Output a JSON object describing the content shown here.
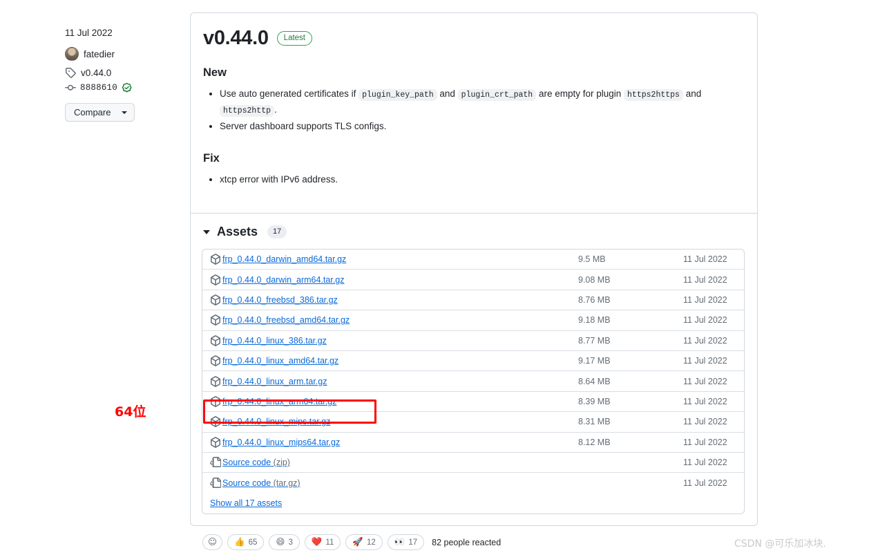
{
  "sidebar": {
    "date": "11 Jul 2022",
    "author": "fatedier",
    "tag": "v0.44.0",
    "commit": "8888610",
    "compare_label": "Compare"
  },
  "release": {
    "title": "v0.44.0",
    "badge": "Latest",
    "sections": [
      {
        "heading": "New",
        "items": [
          {
            "parts": [
              {
                "type": "text",
                "value": "Use auto generated certificates if "
              },
              {
                "type": "code",
                "value": "plugin_key_path"
              },
              {
                "type": "text",
                "value": " and "
              },
              {
                "type": "code",
                "value": "plugin_crt_path"
              },
              {
                "type": "text",
                "value": " are empty for plugin "
              },
              {
                "type": "code",
                "value": "https2https"
              },
              {
                "type": "text",
                "value": " and "
              },
              {
                "type": "code",
                "value": "https2http"
              },
              {
                "type": "text",
                "value": "."
              }
            ]
          },
          {
            "parts": [
              {
                "type": "text",
                "value": "Server dashboard supports TLS configs."
              }
            ]
          }
        ]
      },
      {
        "heading": "Fix",
        "items": [
          {
            "parts": [
              {
                "type": "text",
                "value": "xtcp error with IPv6 address."
              }
            ]
          }
        ]
      }
    ]
  },
  "assets": {
    "title": "Assets",
    "count": "17",
    "show_all_label": "Show all 17 assets",
    "rows": [
      {
        "name": "frp_0.44.0_darwin_amd64.tar.gz",
        "suffix": "",
        "icon": "package-icon",
        "size": "9.5 MB",
        "date": "11 Jul 2022",
        "highlighted": false
      },
      {
        "name": "frp_0.44.0_darwin_arm64.tar.gz",
        "suffix": "",
        "icon": "package-icon",
        "size": "9.08 MB",
        "date": "11 Jul 2022",
        "highlighted": false
      },
      {
        "name": "frp_0.44.0_freebsd_386.tar.gz",
        "suffix": "",
        "icon": "package-icon",
        "size": "8.76 MB",
        "date": "11 Jul 2022",
        "highlighted": false
      },
      {
        "name": "frp_0.44.0_freebsd_amd64.tar.gz",
        "suffix": "",
        "icon": "package-icon",
        "size": "9.18 MB",
        "date": "11 Jul 2022",
        "highlighted": false
      },
      {
        "name": "frp_0.44.0_linux_386.tar.gz",
        "suffix": "",
        "icon": "package-icon",
        "size": "8.77 MB",
        "date": "11 Jul 2022",
        "highlighted": false
      },
      {
        "name": "frp_0.44.0_linux_amd64.tar.gz",
        "suffix": "",
        "icon": "package-icon",
        "size": "9.17 MB",
        "date": "11 Jul 2022",
        "highlighted": false
      },
      {
        "name": "frp_0.44.0_linux_arm.tar.gz",
        "suffix": "",
        "icon": "package-icon",
        "size": "8.64 MB",
        "date": "11 Jul 2022",
        "highlighted": false
      },
      {
        "name": "frp_0.44.0_linux_arm64.tar.gz",
        "suffix": "",
        "icon": "package-icon",
        "size": "8.39 MB",
        "date": "11 Jul 2022",
        "highlighted": true
      },
      {
        "name": "frp_0.44.0_linux_mips.tar.gz",
        "suffix": "",
        "icon": "package-icon",
        "size": "8.31 MB",
        "date": "11 Jul 2022",
        "highlighted": false
      },
      {
        "name": "frp_0.44.0_linux_mips64.tar.gz",
        "suffix": "",
        "icon": "package-icon",
        "size": "8.12 MB",
        "date": "11 Jul 2022",
        "highlighted": false
      },
      {
        "name": "Source code",
        "suffix": " (zip)",
        "icon": "file-code-icon",
        "size": "",
        "date": "11 Jul 2022",
        "highlighted": false
      },
      {
        "name": "Source code",
        "suffix": " (tar.gz)",
        "icon": "file-code-icon",
        "size": "",
        "date": "11 Jul 2022",
        "highlighted": false
      }
    ]
  },
  "reactions": {
    "items": [
      {
        "emoji": "👍",
        "count": "65"
      },
      {
        "emoji": "😄",
        "count": "3"
      },
      {
        "emoji": "❤️",
        "count": "11"
      },
      {
        "emoji": "🚀",
        "count": "12"
      },
      {
        "emoji": "👀",
        "count": "17"
      }
    ],
    "summary": "82 people reacted"
  },
  "annotation": "64位",
  "watermark": "CSDN @可乐加冰块.",
  "colors": {
    "link": "#0969da",
    "latest_green": "#2da44e",
    "annotation_red": "#ff0000",
    "border": "#d0d7de"
  }
}
